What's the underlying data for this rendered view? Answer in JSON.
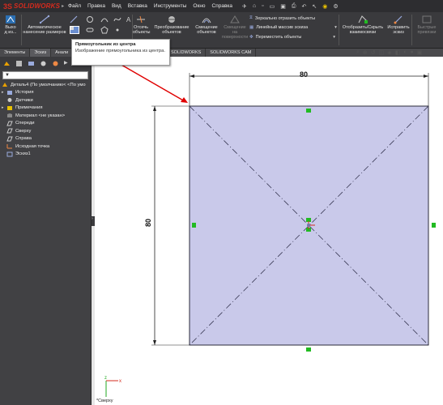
{
  "app": {
    "brand_ds": "3S",
    "brand": "SOLIDWORKS"
  },
  "menu": [
    "Файл",
    "Правка",
    "Вид",
    "Вставка",
    "Инструменты",
    "Окно",
    "Справка"
  ],
  "toolbar": {
    "exit_sketch": "Выхо\nд из...",
    "smart_dimension": "Автоматическое\nнанесение размеров",
    "trim": "Отсечь\nобъекты",
    "convert": "Преобразование\nобъектов",
    "offset": "Смещение\nобъектов",
    "offset_surface": "Смещение\nна\nповерхности",
    "mirror": "Зеркально отразить объекты",
    "linear_pattern": "Линейный массив эскиза",
    "move": "Переместить объекты",
    "display_relations": "Отобразить/Скрыть\nвзаимосвязи",
    "repair": "Исправить\nэскиз",
    "quick_snaps": "Быстрые\nпривязки"
  },
  "tabs": [
    "Элементы",
    "Эскиз",
    "Анали"
  ],
  "tabs_right": [
    "SOLIDWORKS",
    "SOLIDWORKS CAM"
  ],
  "tooltip": {
    "title": "Прямоугольник из центра",
    "body": "Изображение прямоугольника из центра."
  },
  "tree": {
    "root": "Деталь4  (По умолчанию< <По умо",
    "items": [
      {
        "label": "История",
        "icon": "history-icon"
      },
      {
        "label": "Датчики",
        "icon": "sensor-icon"
      },
      {
        "label": "Примечания",
        "icon": "annotations-icon"
      },
      {
        "label": "Материал <не указан>",
        "icon": "material-icon"
      },
      {
        "label": "Спереди",
        "icon": "plane-icon"
      },
      {
        "label": "Сверху",
        "icon": "plane-icon"
      },
      {
        "label": "Справа",
        "icon": "plane-icon"
      },
      {
        "label": "Исходная точка",
        "icon": "origin-icon"
      },
      {
        "label": "Эскиз1",
        "icon": "sketch-icon"
      }
    ]
  },
  "sketch": {
    "dim_width": "80",
    "dim_height": "80",
    "view": "*Сверху"
  },
  "colors": {
    "accent_red": "#d52b1e",
    "sketch_fill": "#c9c9ea",
    "sketch_line": "#2a2a3a",
    "relation_green": "#22bb22"
  }
}
